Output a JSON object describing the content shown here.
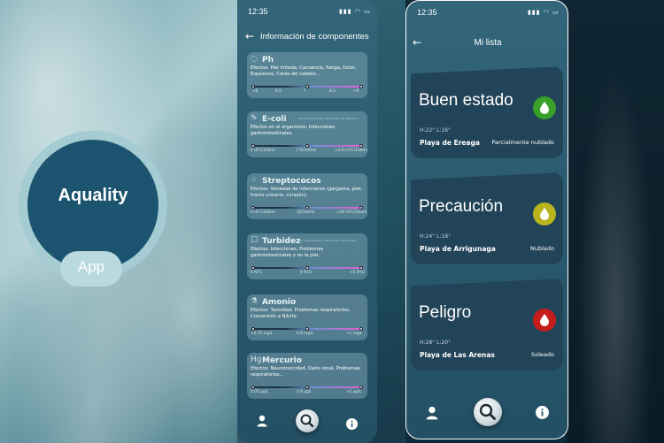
{
  "logo": {
    "title": "Aquality",
    "subtitle": "App"
  },
  "phone1": {
    "time": "12:35",
    "header": "Información de componentes",
    "components": [
      {
        "name": "Ph",
        "icon": "ph-icon",
        "note": "",
        "effects": "Efectos: Piel irritada, Cansancio, Fatiga, Dolor, Espasmos, Caída del cabello...",
        "ticks": [
          "<6",
          "6.5",
          "7",
          "8.5",
          ">9"
        ]
      },
      {
        "name": "E-coli",
        "icon": "bacteria-icon",
        "note": "Ver componentes / información de referencia",
        "effects": "Efectos en el organismo: Infecciones gastrointestinales.",
        "ticks": [
          "0 UFC/100ml",
          "170/100ml",
          ">235 UFC/100ml"
        ]
      },
      {
        "name": "Streptococos",
        "icon": "streptococcus-icon",
        "note": "",
        "effects": "Efectos: Variedad de infecciones (garganta, piel, tracto urinario, corazón).",
        "ticks": [
          "0 UFC/100ml",
          "20/100ml",
          ">40 UFC/100ml"
        ]
      },
      {
        "name": "Turbidez",
        "icon": "turbidity-icon",
        "note": "Ver componentes / información de turbidez",
        "effects": "Efectos: Infecciones, Problemas gastrointestinales y en la piel.",
        "ticks": [
          "0 NTU",
          "4 NTU",
          ">5 NTU"
        ]
      },
      {
        "name": "Amonio",
        "icon": "flask-icon",
        "note": "",
        "effects": "Efectos: Toxicidad, Problemas respiratorios, Conversión a Nitrito.",
        "ticks": [
          "<0.05 mg/L",
          "0.8 mg/L",
          ">1 mg/L"
        ]
      },
      {
        "name": "Mercurio",
        "icon": "mercury-icon",
        "note": "",
        "effects": "Efectos: Neurotoxicidad, Daño renal, Problemas respiratorios...",
        "ticks": [
          "0.05 µg/L",
          "0.8 µg/L",
          ">1 µg/L"
        ]
      }
    ]
  },
  "phone2": {
    "time": "12:35",
    "header": "Mi lista",
    "cards": [
      {
        "status": "Buen estado",
        "temps": "H:22°  L:16°",
        "place": "Playa de Ereaga",
        "condition": "Parcialmente nublado",
        "color": "#3aa02b"
      },
      {
        "status": "Precaución",
        "temps": "H:24°  L:18°",
        "place": "Playa de Arrigunaga",
        "condition": "Nublado",
        "color": "#b8b51e"
      },
      {
        "status": "Peligro",
        "temps": "H:28°  L:20°",
        "place": "Playa de Las Arenas",
        "condition": "Soleado",
        "color": "#c51c1c"
      }
    ]
  },
  "colors": {
    "logo_inner": "#1c5470",
    "logo_ring": "#a4ccd2",
    "good": "#3aa02b",
    "caution": "#b8b51e",
    "danger": "#c51c1c"
  }
}
